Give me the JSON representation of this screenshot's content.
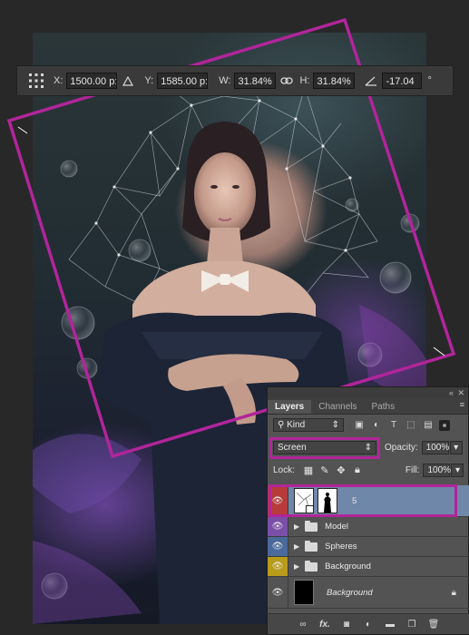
{
  "toolbar": {
    "x_label": "X:",
    "x_value": "1500.00 p:",
    "y_label": "Y:",
    "y_value": "1585.00 p:",
    "w_label": "W:",
    "w_value": "31.84%",
    "h_label": "H:",
    "h_value": "31.84%",
    "angle_value": "-17.04",
    "degree": "°",
    "icons": [
      "reference-point-icon",
      "delta-icon",
      "link-icon",
      "angle-icon"
    ]
  },
  "panel": {
    "tabs": [
      "Layers",
      "Channels",
      "Paths"
    ],
    "filter_kind": "Kind",
    "blend_mode": "Screen",
    "opacity_label": "Opacity:",
    "opacity_value": "100%",
    "lock_label": "Lock:",
    "fill_label": "Fill:",
    "fill_value": "100%",
    "layers": [
      {
        "name": "5",
        "type": "smart-object",
        "eye_color": "#b83a3a",
        "selected": true
      },
      {
        "name": "Model",
        "type": "group",
        "eye_color": "#7a4fa8"
      },
      {
        "name": "Spheres",
        "type": "group",
        "eye_color": "#4a6a9c"
      },
      {
        "name": "Background",
        "type": "group",
        "eye_color": "#b89b1a"
      },
      {
        "name": "Background",
        "type": "pixel",
        "eye_color": "#535353",
        "locked": true
      }
    ],
    "footer_icons": [
      "link-layers-icon",
      "fx-icon",
      "mask-icon",
      "adjustment-icon",
      "new-group-icon",
      "new-layer-icon",
      "trash-icon"
    ],
    "footer_fx": "fx."
  },
  "colors": {
    "highlight": "#b1259a",
    "selected_row": "#6f87a8"
  }
}
